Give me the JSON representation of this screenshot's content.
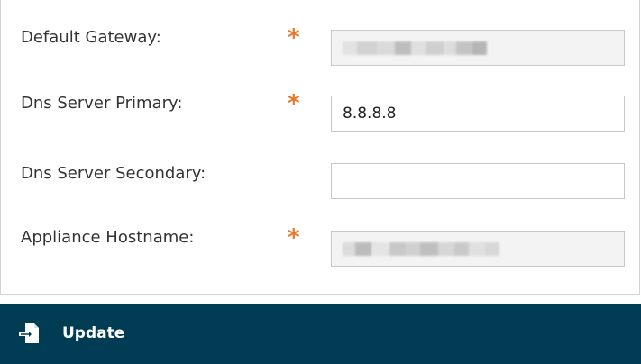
{
  "form": {
    "fields": [
      {
        "label": "Default Gateway:",
        "required": true,
        "value": "",
        "redacted": true
      },
      {
        "label": "Dns Server Primary:",
        "required": true,
        "value": "8.8.8.8",
        "redacted": false
      },
      {
        "label": "Dns Server Secondary:",
        "required": false,
        "value": "",
        "redacted": false
      },
      {
        "label": "Appliance Hostname:",
        "required": true,
        "value": "",
        "redacted": true
      }
    ],
    "required_marker": "*"
  },
  "actions": {
    "update_label": "Update",
    "update_icon": "import-file-icon"
  },
  "colors": {
    "required_marker": "#e8792b",
    "action_bar_bg": "#003d55",
    "action_bar_text": "#ffffff",
    "field_border": "#c8c8c8",
    "disabled_field_bg": "#f3f3f3"
  }
}
